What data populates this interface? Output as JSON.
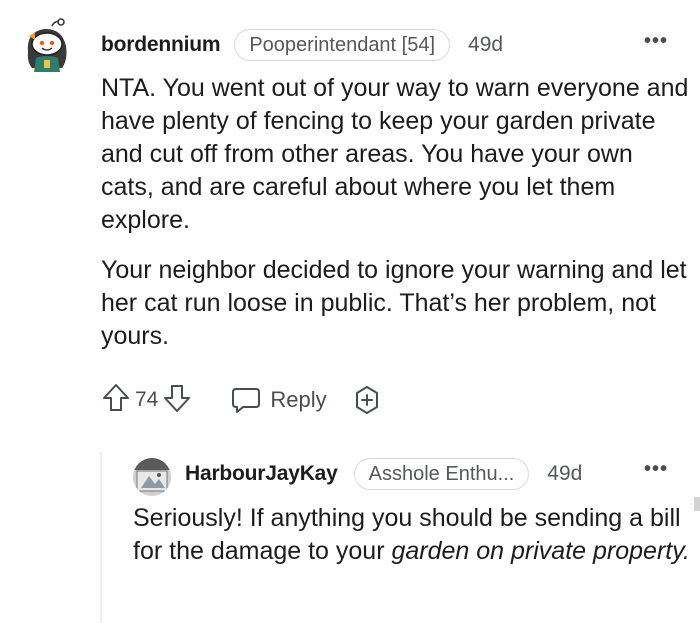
{
  "comments": [
    {
      "username": "bordennium",
      "flair": "Pooperintendant [54]",
      "age": "49d",
      "more": "•••",
      "paragraphs": [
        "NTA. You went out of your way to warn everyone and have plenty of fencing to keep your garden private and cut off from other areas. You have your own cats, and are careful about where you let them explore.",
        "Your neighbor decided to ignore your warning and let her cat run loose in public. That’s her problem, not yours."
      ],
      "votes": "74",
      "reply_label": "Reply",
      "icons": [
        "upvote-icon",
        "downvote-icon",
        "reply-icon",
        "award-icon",
        "more-icon"
      ]
    },
    {
      "username": "HarbourJayKay",
      "flair": "Asshole Enthu...",
      "age": "49d",
      "more": "•••",
      "text_plain": "Seriously! If anything you should be sending a bill for the damage to your ",
      "text_italic": "garden on private property",
      "text_end": "."
    }
  ],
  "colors": {
    "text": "#1c1c1c",
    "muted": "#55585b",
    "border": "#d8dadc",
    "thread_line": "#edeff1"
  }
}
